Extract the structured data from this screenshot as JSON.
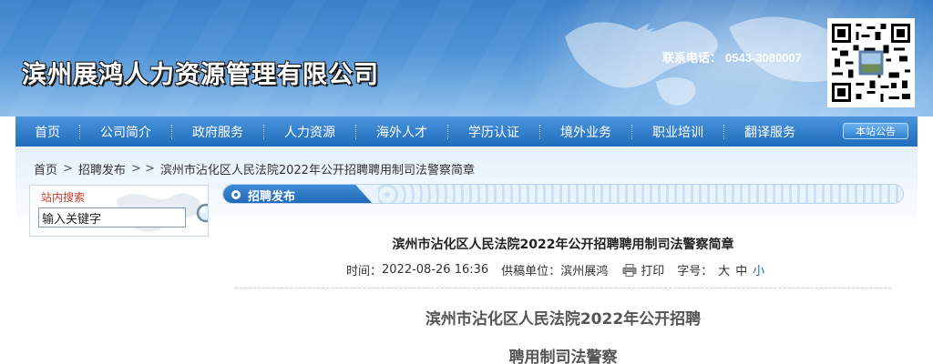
{
  "header": {
    "company_name": "滨州展鸿人力资源管理有限公司",
    "contact_label": "联系电话：",
    "contact_phone": "0543-3080007"
  },
  "nav": {
    "items": [
      {
        "label": "首页"
      },
      {
        "label": "公司简介"
      },
      {
        "label": "政府服务"
      },
      {
        "label": "人力资源"
      },
      {
        "label": "海外人才"
      },
      {
        "label": "学历认证"
      },
      {
        "label": "境外业务"
      },
      {
        "label": "职业培训"
      },
      {
        "label": "翻译服务"
      }
    ],
    "notice_button": "本站公告"
  },
  "breadcrumb": {
    "home": "首页",
    "sep1": ">",
    "category": "招聘发布",
    "sep2": "> >",
    "current": "滨州市沾化区人民法院2022年公开招聘聘用制司法警察简章"
  },
  "search": {
    "title": "站内搜索",
    "input_value": "输入关键字"
  },
  "section": {
    "label": "招聘发布"
  },
  "article": {
    "title": "滨州市沾化区人民法院2022年公开招聘聘用制司法警察简章",
    "time_label": "时间：",
    "time_value": "2022-08-26 16:36",
    "source_label": "供稿单位：",
    "source_value": "滨州展鸿",
    "print_label": "打印",
    "font_size_label": "字号：",
    "font_large": "大",
    "font_medium": "中",
    "font_small": "小",
    "body_line1": "滨州市沾化区人民法院2022年公开招聘",
    "body_line2": "聘用制司法警察"
  },
  "colors": {
    "nav_blue": "#1f6cbc",
    "banner_blue": "#3b7fc8",
    "search_title": "#c0392b",
    "link_blue": "#1e62b0"
  }
}
